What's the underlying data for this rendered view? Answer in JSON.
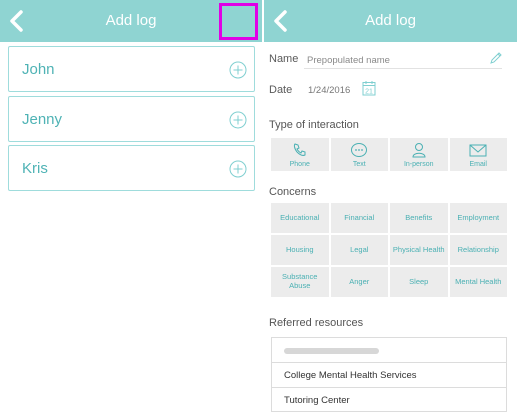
{
  "left_screen": {
    "header": {
      "title": "Add log"
    },
    "people": [
      {
        "name": "John"
      },
      {
        "name": "Jenny"
      },
      {
        "name": "Kris"
      }
    ]
  },
  "right_screen": {
    "header": {
      "title": "Add log"
    },
    "name_label": "Name",
    "name_value": "Prepopulated name",
    "date_label": "Date",
    "date_value": "1/24/2016",
    "calendar_day": "21",
    "interaction_title": "Type of interaction",
    "interaction_types": [
      {
        "label": "Phone",
        "icon": "phone-icon"
      },
      {
        "label": "Text",
        "icon": "text-bubble-icon"
      },
      {
        "label": "In-person",
        "icon": "person-icon"
      },
      {
        "label": "Email",
        "icon": "envelope-icon"
      }
    ],
    "concerns_title": "Concerns",
    "concerns": [
      "Educational",
      "Financial",
      "Benefits",
      "Employment",
      "Housing",
      "Legal",
      "Physical Health",
      "Relationship",
      "Substance Abuse",
      "Anger",
      "Sleep",
      "Mental Health"
    ],
    "resources_title": "Referred resources",
    "resources": [
      "College Mental Health Services",
      "Tutoring Center"
    ]
  },
  "colors": {
    "header": "#8fd4d2",
    "accent": "#4ab0b3",
    "highlight": "#e000e6"
  }
}
